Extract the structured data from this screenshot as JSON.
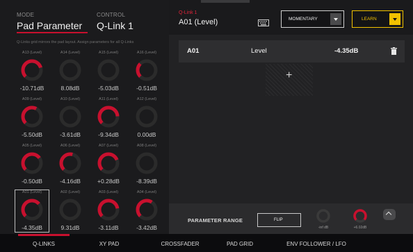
{
  "left_panel": {
    "mode_label": "MODE",
    "mode_value": "Pad Parameter",
    "control_label": "CONTROL",
    "control_value": "Q-Link 1",
    "hint": "Q-Links grid mirrors the pad layout. Assign parameters for all Q-Links",
    "knobs": [
      {
        "label": "A13 (Level)",
        "value": "-10.71dB",
        "level": 0.77,
        "selected": false
      },
      {
        "label": "A14 (Level)",
        "value": "8.08dB",
        "level": 0.0,
        "selected": false
      },
      {
        "label": "A15 (Level)",
        "value": "-5.03dB",
        "level": 0.0,
        "selected": false
      },
      {
        "label": "A16 (Level)",
        "value": "-0.51dB",
        "level": 0.33,
        "selected": false
      },
      {
        "label": "A09 (Level)",
        "value": "-5.50dB",
        "level": 0.6,
        "selected": false
      },
      {
        "label": "A10 (Level)",
        "value": "-3.61dB",
        "level": 0.0,
        "selected": false
      },
      {
        "label": "A11 (Level)",
        "value": "-9.34dB",
        "level": 0.82,
        "selected": false
      },
      {
        "label": "A12 (Level)",
        "value": "0.00dB",
        "level": 0.0,
        "selected": false
      },
      {
        "label": "A05 (Level)",
        "value": "-0.50dB",
        "level": 0.7,
        "selected": false
      },
      {
        "label": "A06 (Level)",
        "value": "-4.16dB",
        "level": 0.55,
        "selected": false
      },
      {
        "label": "A07 (Level)",
        "value": "+0.28dB",
        "level": 0.75,
        "selected": false
      },
      {
        "label": "A08 (Level)",
        "value": "-8.39dB",
        "level": 0.0,
        "selected": false
      },
      {
        "label": "A01 (Level)",
        "value": "-4.35dB",
        "level": 0.68,
        "selected": true
      },
      {
        "label": "A02 (Level)",
        "value": "9.31dB",
        "level": 0.0,
        "selected": false
      },
      {
        "label": "A03 (Level)",
        "value": "-3.11dB",
        "level": 0.8,
        "selected": false
      },
      {
        "label": "A04 (Level)",
        "value": "-3.42dB",
        "level": 0.62,
        "selected": false
      }
    ]
  },
  "right_panel": {
    "qlink_label": "Q-Link 1",
    "qlink_value": "A01 (Level)",
    "mode_button": "MOMENTARY",
    "learn_button": "LEARN",
    "assignment": {
      "pad": "A01",
      "param": "Level",
      "value": "-4.35dB"
    },
    "add_symbol": "+",
    "range": {
      "label": "PARAMETER RANGE",
      "flip": "FLIP",
      "min_value": "-inf dB",
      "max_value": "+6.02dB"
    }
  },
  "tabs": [
    {
      "label": "Q-LINKS",
      "active": true
    },
    {
      "label": "XY PAD",
      "active": false
    },
    {
      "label": "CROSSFADER",
      "active": false
    },
    {
      "label": "PAD GRID",
      "active": false
    },
    {
      "label": "ENV FOLLOWER / LFO",
      "active": false
    }
  ],
  "colors": {
    "accent": "#c8102e",
    "learn": "#f2c200",
    "knob_ring": "#2a2a2a"
  }
}
